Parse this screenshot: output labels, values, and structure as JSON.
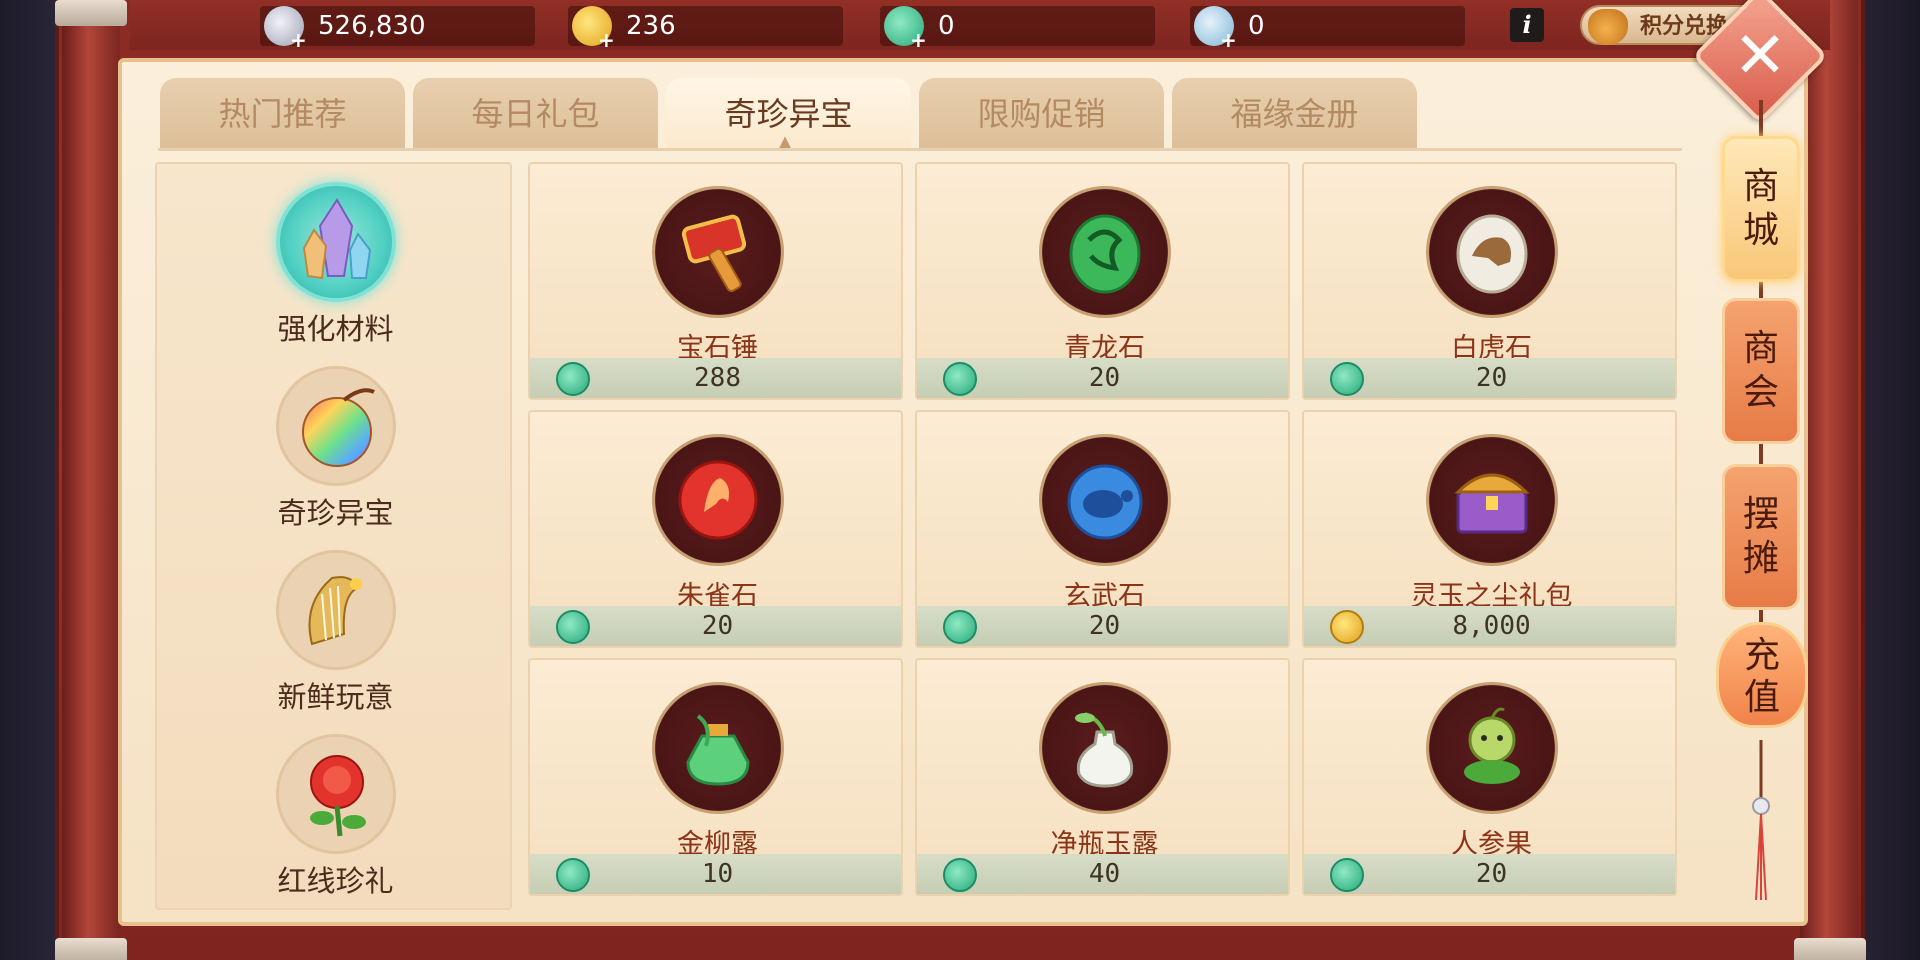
{
  "currencies": [
    {
      "name": "silver-coin",
      "value": "526,830",
      "color": "#c9c9d6"
    },
    {
      "name": "gold-coin",
      "value": "236",
      "color": "#f2b62c"
    },
    {
      "name": "jade-pendant",
      "value": "0",
      "color": "#38c59b"
    },
    {
      "name": "gem-bag",
      "value": "0",
      "color": "#7fb6d8"
    }
  ],
  "exchange_label": "积分兑换",
  "close_label": "✕",
  "tabs": [
    {
      "label": "热门推荐",
      "active": false
    },
    {
      "label": "每日礼包",
      "active": false
    },
    {
      "label": "奇珍异宝",
      "active": true
    },
    {
      "label": "限购促销",
      "active": false
    },
    {
      "label": "福缘金册",
      "active": false
    }
  ],
  "categories": [
    {
      "label": "强化材料",
      "icon": "crystal-icon",
      "active": true
    },
    {
      "label": "奇珍异宝",
      "icon": "rainbow-orb-icon",
      "active": false
    },
    {
      "label": "新鲜玩意",
      "icon": "harp-icon",
      "active": false
    },
    {
      "label": "红线珍礼",
      "icon": "rose-icon",
      "active": false
    }
  ],
  "items": [
    {
      "name": "宝石锤",
      "price": "288",
      "currency": "jade",
      "icon": "hammer-icon"
    },
    {
      "name": "青龙石",
      "price": "20",
      "currency": "jade",
      "icon": "green-dragon-stone-icon"
    },
    {
      "name": "白虎石",
      "price": "20",
      "currency": "jade",
      "icon": "white-tiger-stone-icon"
    },
    {
      "name": "朱雀石",
      "price": "20",
      "currency": "jade",
      "icon": "red-phoenix-stone-icon"
    },
    {
      "name": "玄武石",
      "price": "20",
      "currency": "jade",
      "icon": "black-tortoise-stone-icon"
    },
    {
      "name": "灵玉之尘礼包",
      "price": "8,000",
      "currency": "gold",
      "icon": "treasure-chest-icon"
    },
    {
      "name": "金柳露",
      "price": "10",
      "currency": "jade",
      "icon": "willow-dew-bottle-icon"
    },
    {
      "name": "净瓶玉露",
      "price": "40",
      "currency": "jade",
      "icon": "jade-vase-icon"
    },
    {
      "name": "人参果",
      "price": "20",
      "currency": "jade",
      "icon": "ginseng-fruit-icon"
    }
  ],
  "side_tabs": [
    {
      "label1": "商",
      "label2": "城",
      "active": true
    },
    {
      "label1": "商",
      "label2": "会",
      "active": false
    },
    {
      "label1": "摆",
      "label2": "摊",
      "active": false
    }
  ],
  "recharge": {
    "label1": "充",
    "label2": "值"
  }
}
